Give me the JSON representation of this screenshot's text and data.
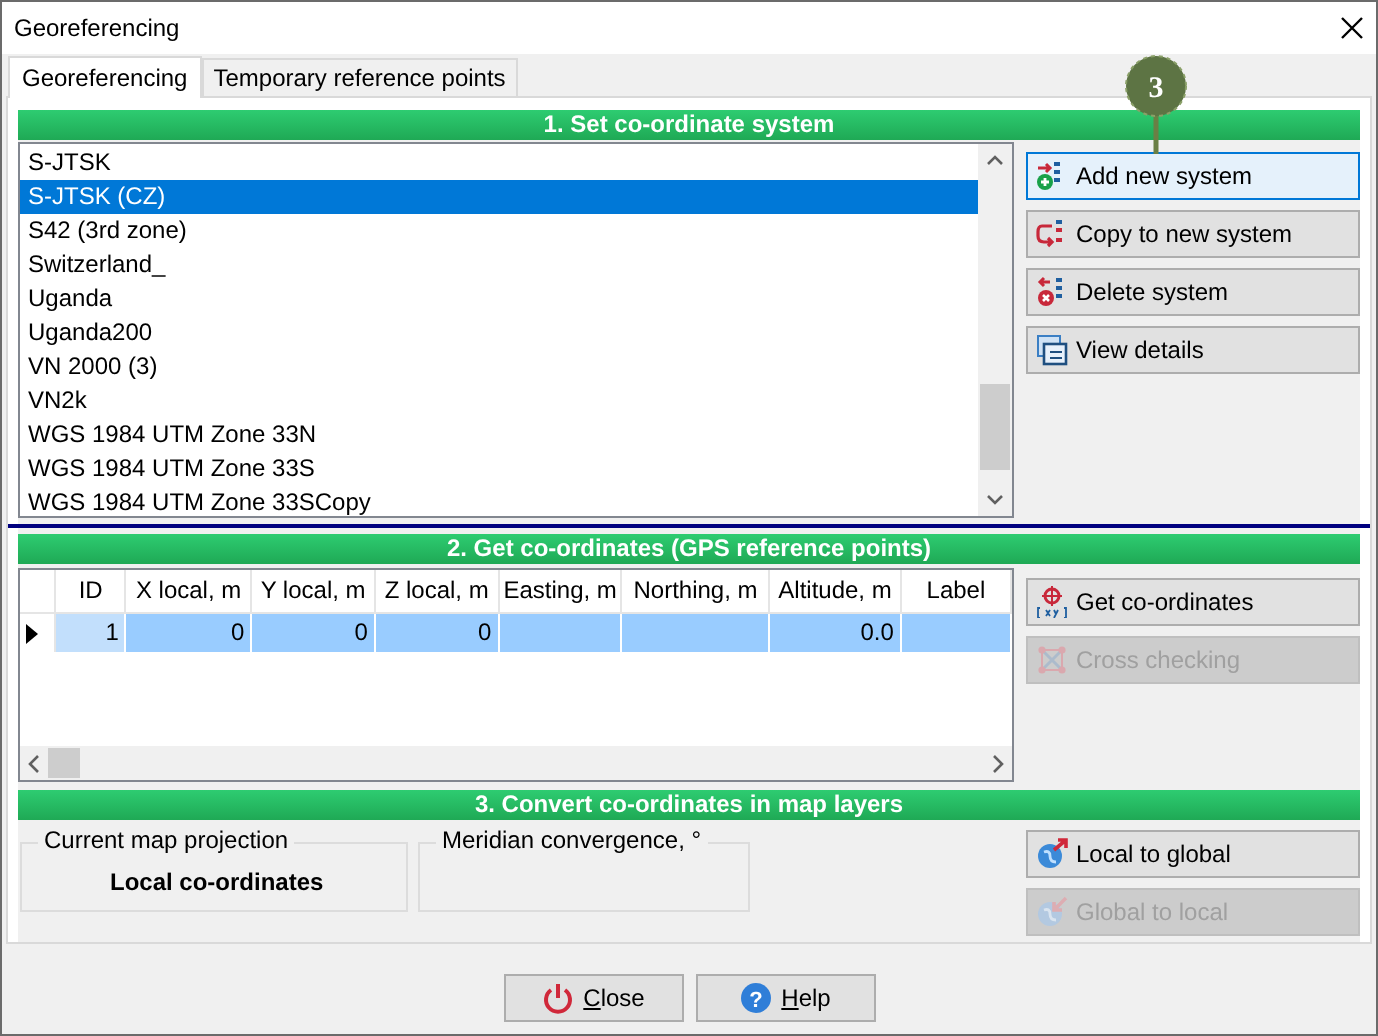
{
  "window": {
    "title": "Georeferencing"
  },
  "tabs": [
    {
      "label": "Georeferencing",
      "selected": true
    },
    {
      "label": "Temporary reference points",
      "selected": false
    }
  ],
  "callout": {
    "label": "3"
  },
  "section1": {
    "header": "1. Set co-ordinate system",
    "systems": [
      {
        "name": "S-JTSK",
        "selected": false
      },
      {
        "name": "S-JTSK (CZ)",
        "selected": true
      },
      {
        "name": "S42 (3rd zone)",
        "selected": false
      },
      {
        "name": "Switzerland_",
        "selected": false
      },
      {
        "name": "Uganda",
        "selected": false
      },
      {
        "name": "Uganda200",
        "selected": false
      },
      {
        "name": "VN 2000 (3)",
        "selected": false
      },
      {
        "name": "VN2k",
        "selected": false
      },
      {
        "name": "WGS 1984 UTM Zone 33N",
        "selected": false
      },
      {
        "name": "WGS 1984 UTM Zone 33S",
        "selected": false
      },
      {
        "name": "WGS 1984 UTM Zone 33SCopy",
        "selected": false
      }
    ],
    "buttons": [
      {
        "kind": "add",
        "label": "Add new system",
        "disabled": false,
        "hover": true
      },
      {
        "kind": "copy",
        "label": "Copy to new system",
        "disabled": false,
        "hover": false
      },
      {
        "kind": "delete",
        "label": "Delete system",
        "disabled": false,
        "hover": false
      },
      {
        "kind": "details",
        "label": "View details",
        "disabled": false,
        "hover": false
      }
    ]
  },
  "section2": {
    "header": "2. Get co-ordinates (GPS reference points)",
    "columns": [
      "ID",
      "X local, m",
      "Y local, m",
      "Z local, m",
      "Easting, m",
      "Northing, m",
      "Altitude, m",
      "Label"
    ],
    "rows": [
      {
        "current": true,
        "selected": true,
        "cells": [
          "1",
          "0",
          "0",
          "0",
          "",
          "",
          "0.0",
          ""
        ]
      }
    ],
    "buttons": [
      {
        "kind": "getcoords",
        "label": "Get co-ordinates",
        "disabled": false,
        "hover": false
      },
      {
        "kind": "cross",
        "label": "Cross checking",
        "disabled": true,
        "hover": false
      }
    ]
  },
  "section3": {
    "header": "3. Convert co-ordinates in map layers",
    "projection": {
      "legend": "Current map projection",
      "value": "Local co-ordinates"
    },
    "convergence": {
      "legend": "Meridian convergence, °"
    },
    "buttons": [
      {
        "kind": "toglobal",
        "label": "Local to global",
        "disabled": false,
        "hover": false
      },
      {
        "kind": "tolocal",
        "label": "Global to local",
        "disabled": true,
        "hover": false
      }
    ]
  },
  "footer": [
    {
      "kind": "close",
      "label": "Close",
      "underline_first": true
    },
    {
      "kind": "help",
      "label": "Help",
      "underline_first": true,
      "glyph": "?"
    }
  ]
}
